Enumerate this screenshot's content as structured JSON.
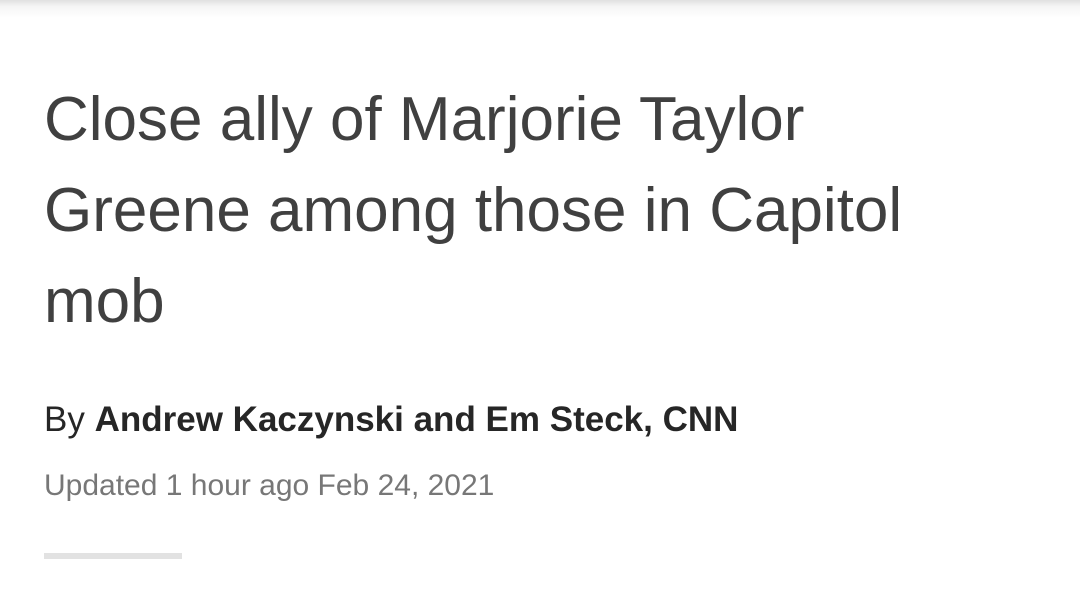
{
  "article": {
    "headline": "Close ally of Marjorie Taylor Greene among those in Capitol mob",
    "byline_prefix": "By",
    "byline_authors": "Andrew Kaczynski and Em Steck, CNN",
    "updated_label": "Updated 1 hour ago Feb 24, 2021"
  }
}
